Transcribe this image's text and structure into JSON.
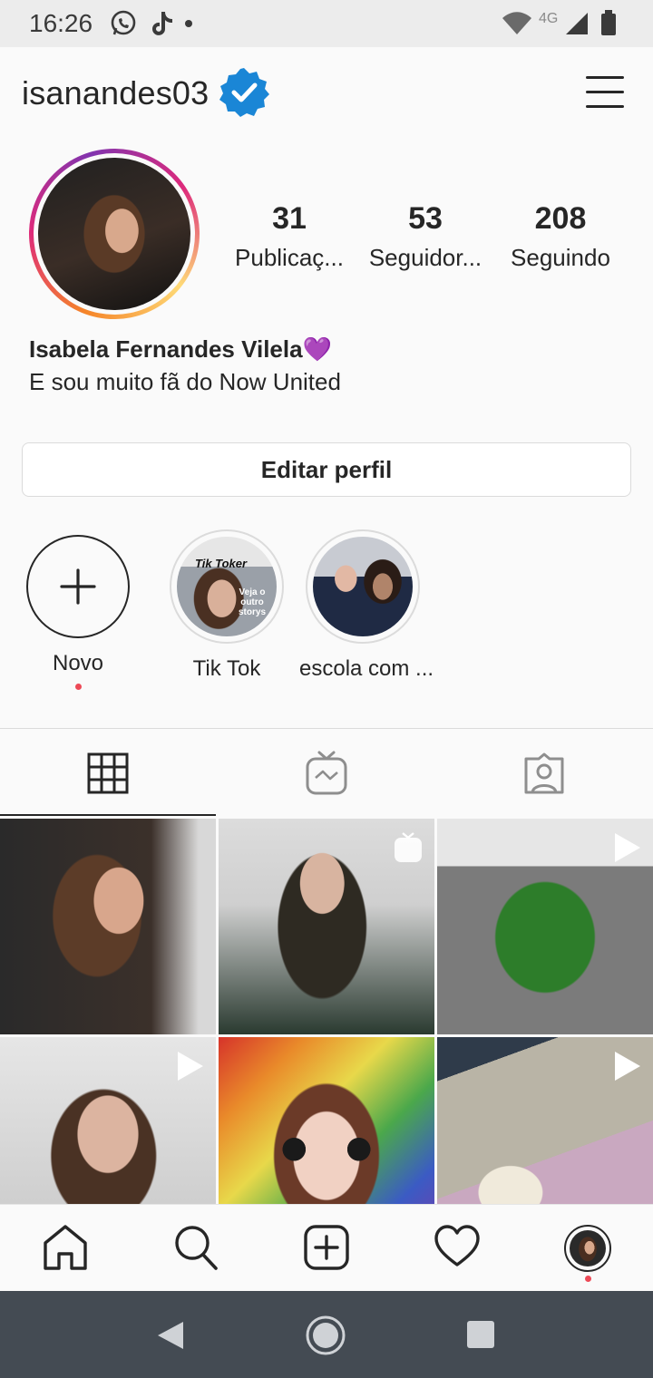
{
  "status_bar": {
    "time": "16:26",
    "network": "4G"
  },
  "header": {
    "username": "isanandes03"
  },
  "profile": {
    "stats": [
      {
        "count": "31",
        "label": "Publicaç..."
      },
      {
        "count": "53",
        "label": "Seguidor..."
      },
      {
        "count": "208",
        "label": "Seguindo"
      }
    ],
    "name": "Isabela Fernandes Vilela💜",
    "bio": "E sou muito fã do Now United",
    "edit_label": "Editar perfil"
  },
  "highlights": [
    {
      "label": "Novo"
    },
    {
      "label": "Tik Tok",
      "overlay_top": "Tik Toker",
      "overlay_bottom": "Veja o outro storys"
    },
    {
      "label": "escola com ..."
    }
  ],
  "tabs": [
    "grid-icon",
    "igtv-icon",
    "tagged-icon"
  ],
  "grid": [
    {
      "badge": "none"
    },
    {
      "badge": "igtv"
    },
    {
      "badge": "video"
    },
    {
      "badge": "video"
    },
    {
      "badge": "none"
    },
    {
      "badge": "video"
    }
  ],
  "bottom_nav": [
    "home-icon",
    "search-icon",
    "add-post-icon",
    "heart-icon",
    "profile-avatar"
  ],
  "colors": {
    "verified": "#1a86d6",
    "notification": "#ed4956",
    "text": "#262626",
    "border": "#dbdbdb"
  }
}
